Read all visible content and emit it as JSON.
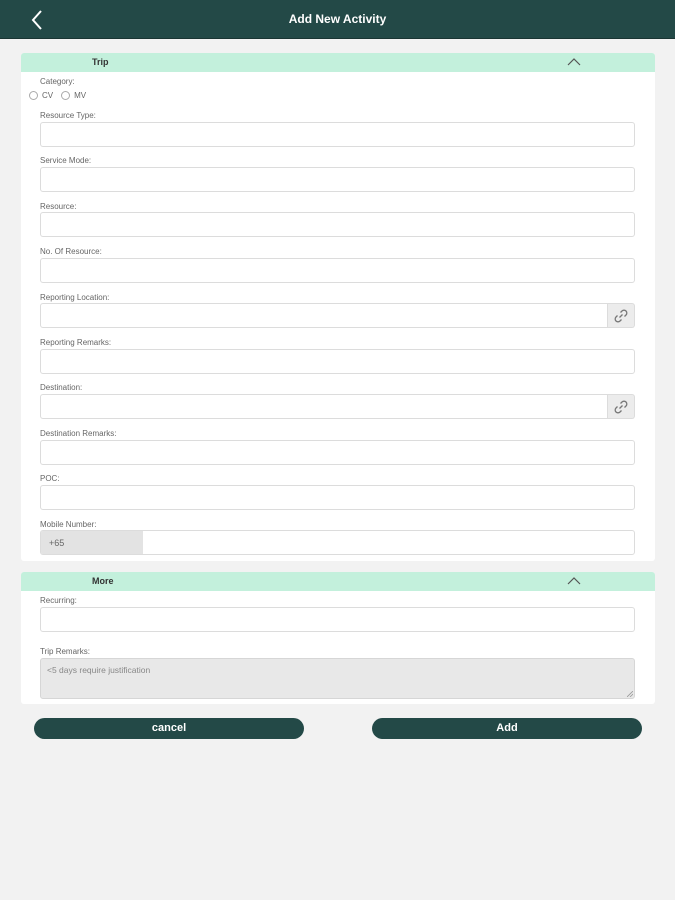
{
  "header": {
    "title": "Add New Activity"
  },
  "trip_section": {
    "title": "Trip",
    "category_label": "Category:",
    "category_options": [
      "CV",
      "MV"
    ],
    "resource_type_label": "Resource Type:",
    "service_mode_label": "Service Mode:",
    "resource_label": "Resource:",
    "no_of_resource_label": "No. Of Resource:",
    "reporting_location_label": "Reporting Location:",
    "reporting_remarks_label": "Reporting Remarks:",
    "destination_label": "Destination:",
    "destination_remarks_label": "Destination Remarks:",
    "poc_label": "POC:",
    "mobile_number_label": "Mobile Number:",
    "mobile_prefix": "+65"
  },
  "more_section": {
    "title": "More",
    "recurring_label": "Recurring:",
    "trip_remarks_label": "Trip Remarks:",
    "trip_remarks_placeholder": "<5 days require justification"
  },
  "actions": {
    "cancel_label": "cancel",
    "add_label": "Add"
  },
  "colors": {
    "primary": "#234947",
    "section_header": "#c3f0dc",
    "background": "#f2f2f2"
  },
  "icons": {
    "back": "chevron-left-icon",
    "collapse": "chevron-up-icon",
    "link": "link-icon"
  }
}
